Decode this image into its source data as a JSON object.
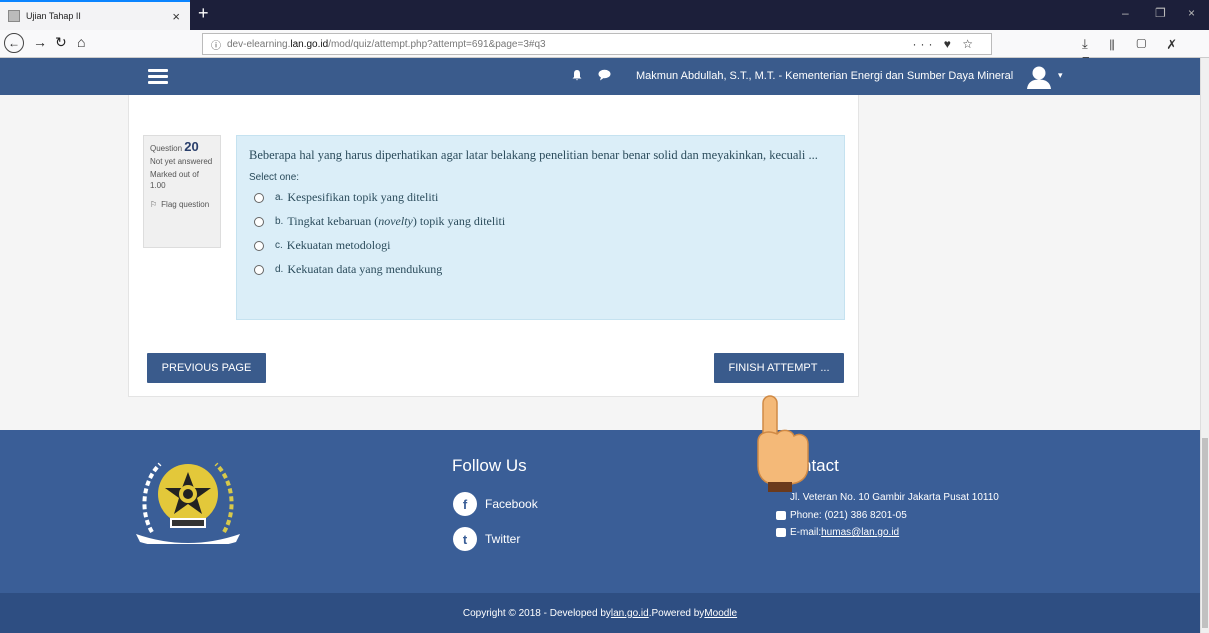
{
  "browser": {
    "tab_title": "Ujian Tahap II",
    "tab_close": "×",
    "new_tab": "+",
    "url_prefix": "dev-elearning.",
    "url_domain": "lan.go.id",
    "url_path": "/mod/quiz/attempt.php?attempt=691&page=3#q3",
    "url_actions": "··· ♥ ☆",
    "toolbar_icons": "⤓ ⫴ ▢ ✗ ≡",
    "window_controls": [
      "–",
      "❐",
      "×"
    ]
  },
  "header": {
    "user_name": "Makmun Abdullah, S.T., M.T. - Kementerian Energi dan Sumber Daya Mineral",
    "caret": "▾",
    "bell": "🔔",
    "chat": "💬"
  },
  "question_info": {
    "label": "Question",
    "number": "20",
    "status": "Not yet answered",
    "marked": "Marked out of 1.00",
    "flag_icon": "⚐",
    "flag_label": "Flag question"
  },
  "question": {
    "text": "Beberapa hal yang harus diperhatikan agar latar belakang penelitian benar benar solid dan meyakinkan, kecuali ...",
    "prompt": "Select one:",
    "options": [
      {
        "letter": "a.",
        "text_before": "Kespesifikan topik yang diteliti",
        "italic": "",
        "text_after": ""
      },
      {
        "letter": "b.",
        "text_before": "Tingkat kebaruan (",
        "italic": "novelty",
        "text_after": ") topik yang diteliti"
      },
      {
        "letter": "c.",
        "text_before": "Kekuatan metodologi",
        "italic": "",
        "text_after": ""
      },
      {
        "letter": "d.",
        "text_before": "Kekuatan data yang mendukung",
        "italic": "",
        "text_after": ""
      }
    ]
  },
  "buttons": {
    "previous": "PREVIOUS PAGE",
    "finish": "FINISH ATTEMPT ..."
  },
  "footer": {
    "follow_title": "Follow Us",
    "facebook": "Facebook",
    "facebook_icon": "f",
    "twitter": "Twitter",
    "twitter_icon": "t",
    "contact_title": "ntact",
    "address": "Jl. Veteran No. 10 Gambir Jakarta Pusat 10110",
    "phone": "Phone: (021) 386 8201-05",
    "email_label": "E-mail: ",
    "email": "humas@lan.go.id",
    "copyright_prefix": "Copyright © 2018 - Developed by ",
    "developer_link": "lan.go.id",
    "powered_by": ".Powered by ",
    "moodle_link": "Moodle"
  },
  "colors": {
    "header_bg": "#3a5b8c",
    "footer_bg": "#3a5e97",
    "question_bg": "#dbeef8",
    "button_bg": "#3a5b8c"
  }
}
